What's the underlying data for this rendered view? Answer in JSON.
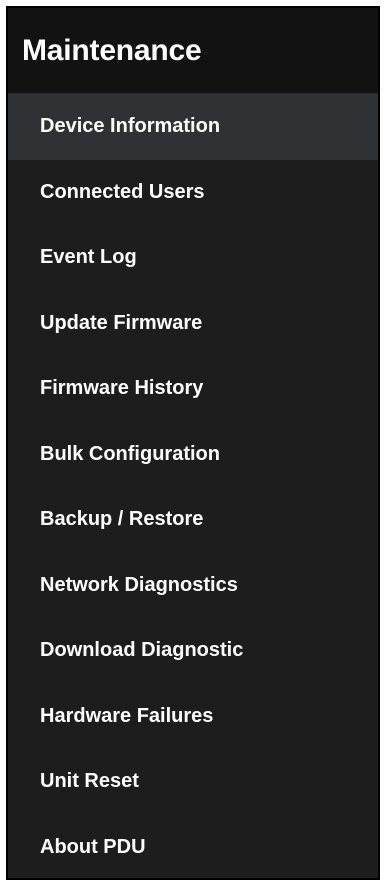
{
  "sidebar": {
    "title": "Maintenance",
    "active_index": 0,
    "items": [
      {
        "label": "Device Information"
      },
      {
        "label": "Connected Users"
      },
      {
        "label": "Event Log"
      },
      {
        "label": "Update Firmware"
      },
      {
        "label": "Firmware History"
      },
      {
        "label": "Bulk Configuration"
      },
      {
        "label": "Backup / Restore"
      },
      {
        "label": "Network Diagnostics"
      },
      {
        "label": "Download Diagnostic"
      },
      {
        "label": "Hardware Failures"
      },
      {
        "label": "Unit Reset"
      },
      {
        "label": "About PDU"
      }
    ]
  },
  "colors": {
    "panel_background": "#1d1d1d",
    "header_background": "#121212",
    "active_item_background": "#2f3134",
    "text": "#ffffff"
  }
}
